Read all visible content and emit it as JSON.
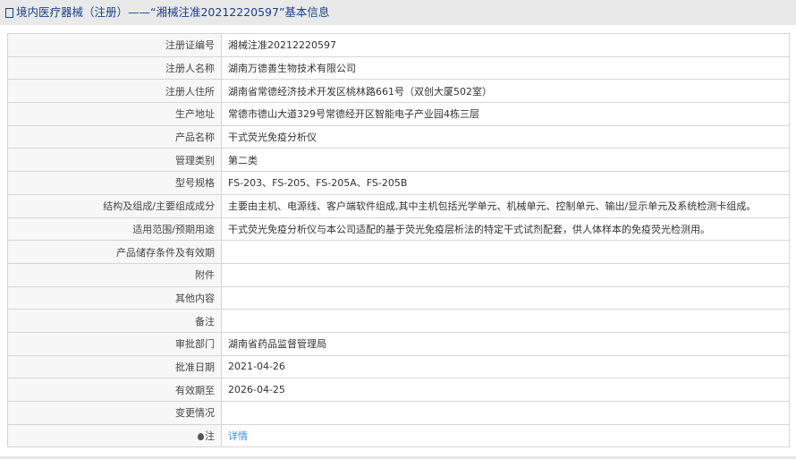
{
  "header": {
    "title": "境内医疗器械（注册）——“湘械注准20212220597”基本信息"
  },
  "rows": [
    {
      "label": "注册证编号",
      "value": "湘械注准20212220597"
    },
    {
      "label": "注册人名称",
      "value": "湖南万德善生物技术有限公司"
    },
    {
      "label": "注册人住所",
      "value": "湖南省常德经济技术开发区桃林路661号（双创大厦502室）"
    },
    {
      "label": "生产地址",
      "value": "常德市德山大道329号常德经开区智能电子产业园4栋三层"
    },
    {
      "label": "产品名称",
      "value": "干式荧光免疫分析仪"
    },
    {
      "label": "管理类别",
      "value": "第二类"
    },
    {
      "label": "型号规格",
      "value": "FS-203、FS-205、FS-205A、FS-205B"
    },
    {
      "label": "结构及组成/主要组成成分",
      "value": "主要由主机、电源线、客户端软件组成,其中主机包括光学单元、机械单元、控制单元、输出/显示单元及系统检测卡组成。"
    },
    {
      "label": "适用范围/预期用途",
      "value": "干式荧光免疫分析仪与本公司适配的基于荧光免疫层析法的特定干式试剂配套，供人体样本的免疫荧光检测用。"
    },
    {
      "label": "产品储存条件及有效期",
      "value": ""
    },
    {
      "label": "附件",
      "value": ""
    },
    {
      "label": "其他内容",
      "value": ""
    },
    {
      "label": "备注",
      "value": ""
    },
    {
      "label": "审批部门",
      "value": "湖南省药品监督管理局"
    },
    {
      "label": "批准日期",
      "value": "2021-04-26"
    },
    {
      "label": "有效期至",
      "value": "2026-04-25"
    },
    {
      "label": "变更情况",
      "value": ""
    }
  ],
  "note": {
    "label": "注",
    "link": "详情"
  }
}
